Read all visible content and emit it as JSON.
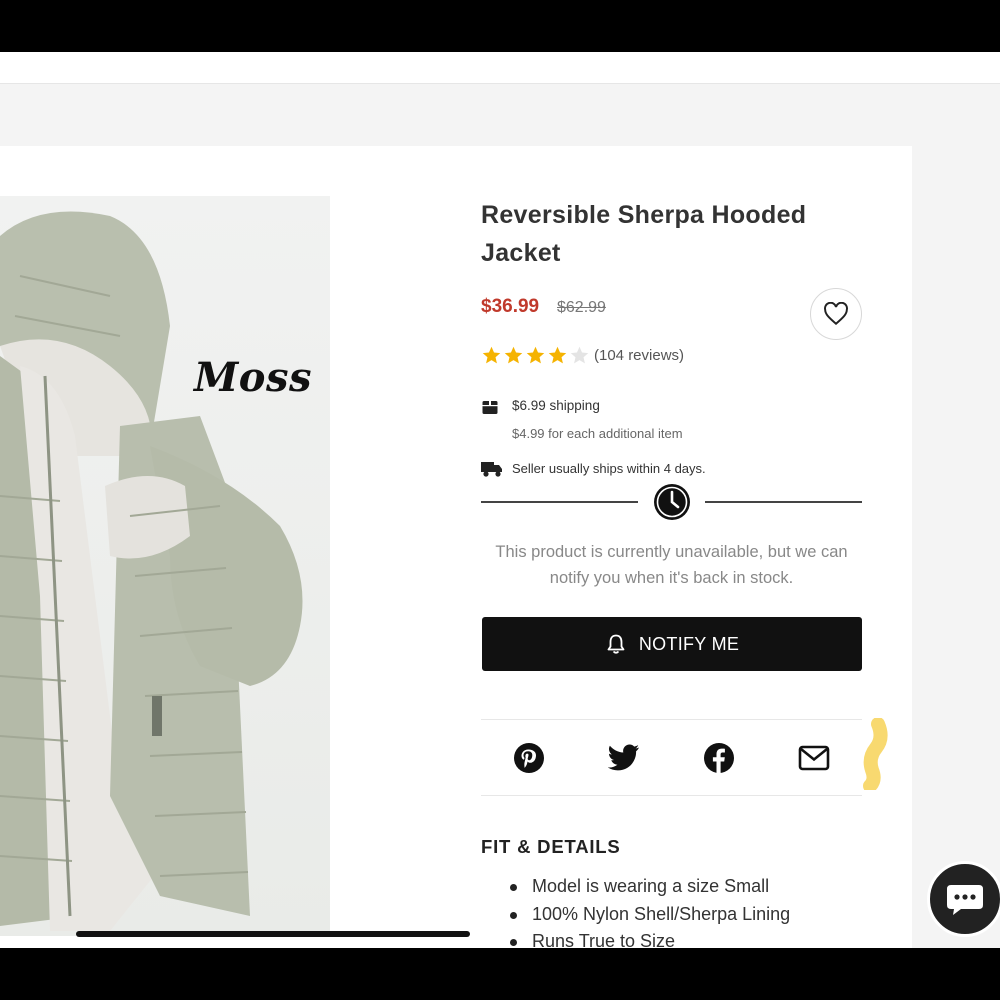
{
  "product": {
    "title": "Reversible Sherpa Hooded Jacket",
    "price_sale": "$36.99",
    "price_original": "$62.99",
    "rating": 4,
    "rating_max": 5,
    "review_count": "(104 reviews)",
    "image_caption": "Moss"
  },
  "shipping": {
    "cost": "$6.99 shipping",
    "additional": "$4.99 for each additional item",
    "ships_within": "Seller usually ships within 4 days."
  },
  "availability": {
    "message": "This product is currently unavailable, but we can notify you when it's back in stock.",
    "notify_label": "NOTIFY ME"
  },
  "share": {
    "icons": [
      "pinterest-icon",
      "twitter-icon",
      "facebook-icon",
      "email-icon"
    ]
  },
  "details": {
    "heading": "FIT & DETAILS",
    "items": [
      "Model is wearing a size Small",
      "100% Nylon Shell/Sherpa Lining",
      "Runs True to Size"
    ]
  },
  "colors": {
    "sale_price": "#c0392b",
    "star": "#f5b301",
    "button_bg": "#111111",
    "highlight": "#f7d560"
  }
}
